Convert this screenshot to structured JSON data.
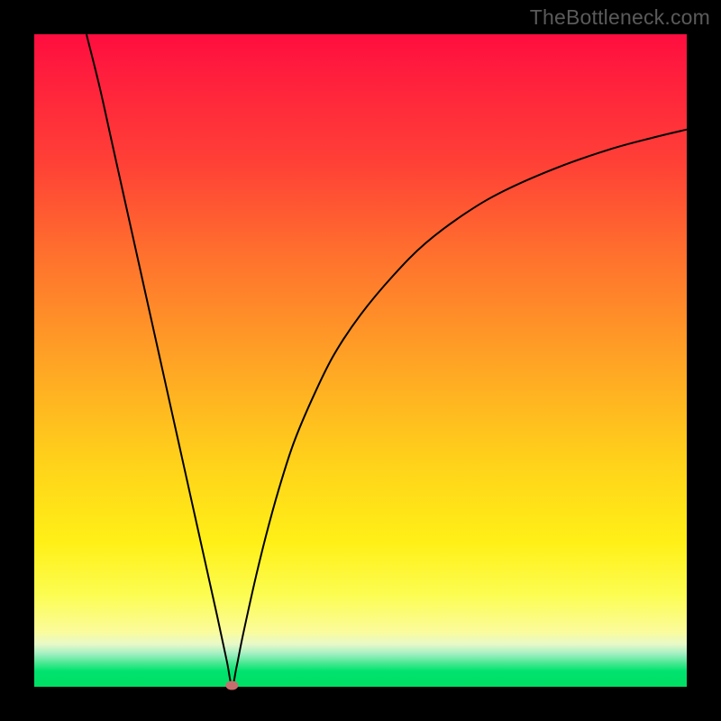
{
  "watermark": "TheBottleneck.com",
  "chart_data": {
    "type": "line",
    "title": "",
    "xlabel": "",
    "ylabel": "",
    "xlim": [
      0,
      100
    ],
    "ylim": [
      0,
      100
    ],
    "grid": false,
    "legend": false,
    "background_gradient": {
      "top": "#ff0d3f",
      "mid1": "#ff6e2e",
      "mid2": "#ffd31a",
      "band": "#fcfd52",
      "bottom": "#00e070"
    },
    "series": [
      {
        "name": "bottleneck-curve",
        "type": "line",
        "color": "#000000",
        "x": [
          8,
          10,
          12,
          14,
          16,
          18,
          20,
          22,
          24,
          26,
          28,
          29.5,
          30.3,
          31,
          32,
          34,
          36,
          38,
          40,
          43,
          46,
          50,
          55,
          60,
          66,
          72,
          80,
          88,
          95,
          100
        ],
        "y": [
          100,
          92,
          83,
          74,
          65,
          56,
          47,
          38,
          29,
          20,
          11,
          4,
          0.2,
          3,
          8,
          17,
          25,
          32,
          38,
          45,
          51,
          57,
          63,
          68,
          72.5,
          76,
          79.5,
          82.3,
          84.2,
          85.4
        ]
      }
    ],
    "annotations": [
      {
        "type": "point-marker",
        "name": "minimum-marker",
        "x": 30.3,
        "y": 0.2,
        "color": "#c76d6e",
        "shape": "ellipse"
      }
    ]
  }
}
